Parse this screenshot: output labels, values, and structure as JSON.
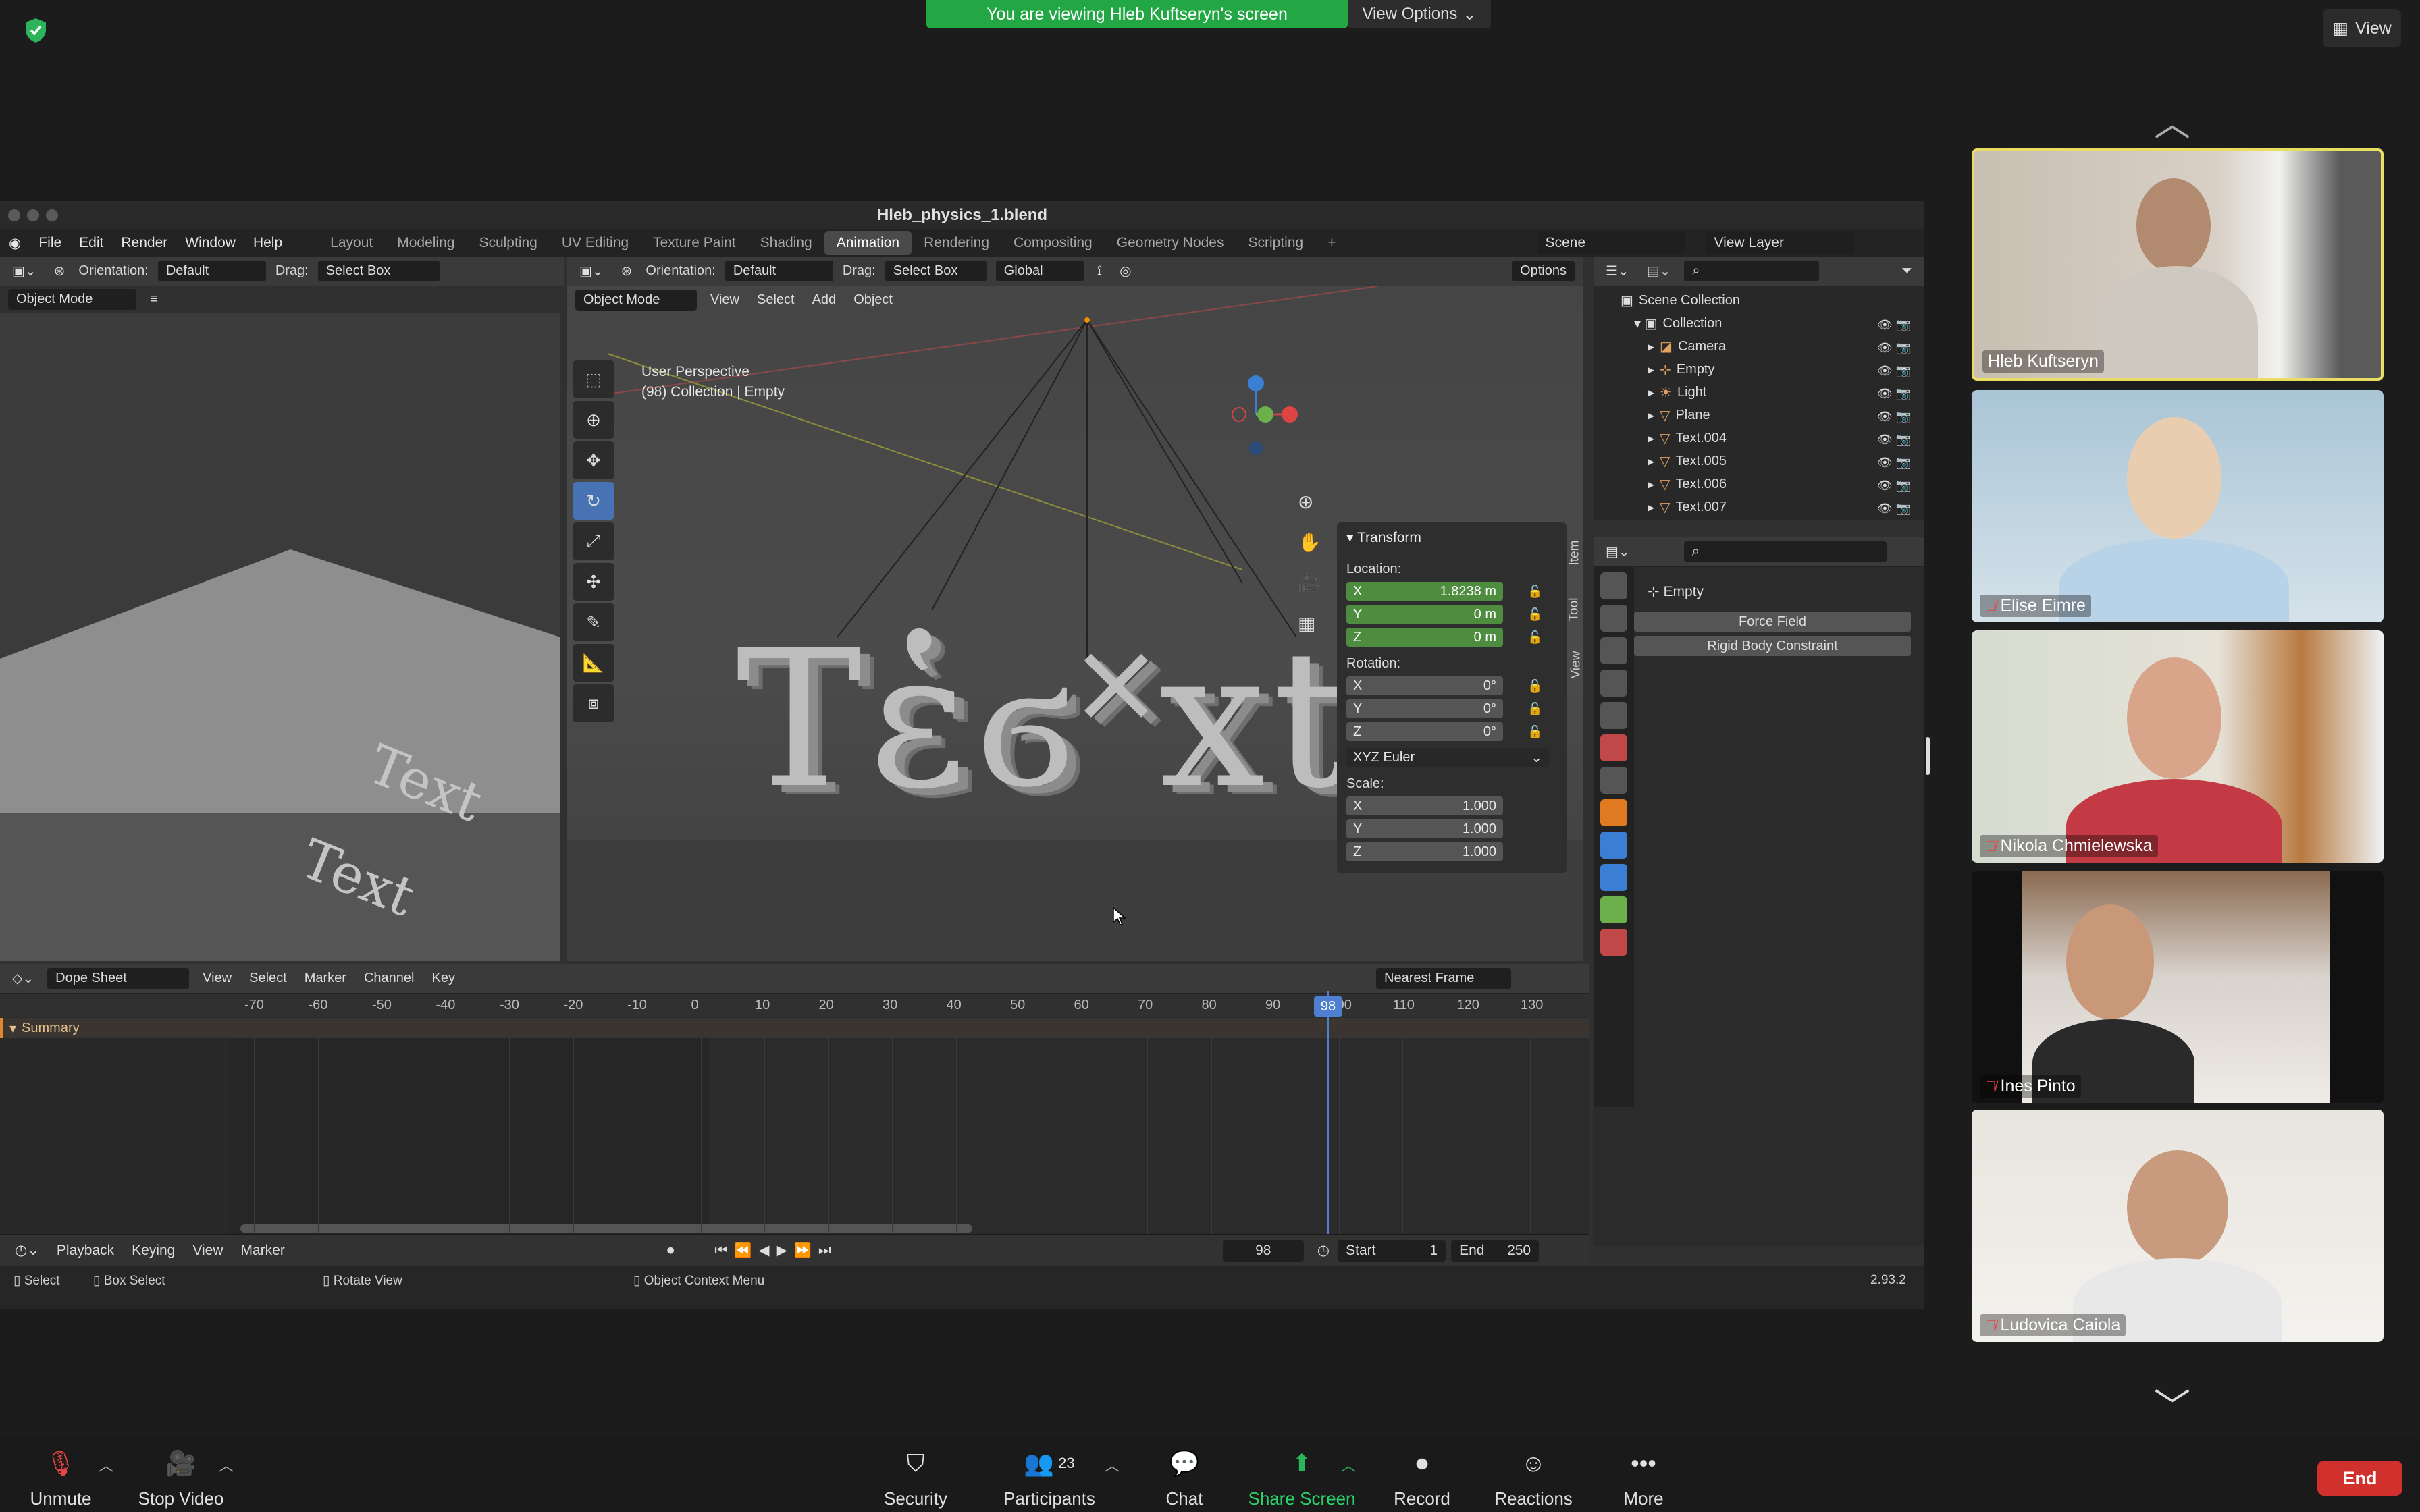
{
  "zoom": {
    "banner_text": "You are viewing Hleb Kuftseryn's screen",
    "view_options_label": "View Options",
    "view_label": "View",
    "bottom_bar": {
      "unmute": "Unmute",
      "stop_video": "Stop Video",
      "security": "Security",
      "participants": "Participants",
      "participants_count": "23",
      "chat": "Chat",
      "share_screen": "Share Screen",
      "record": "Record",
      "reactions": "Reactions",
      "more": "More",
      "end": "End"
    },
    "participants": [
      {
        "name": "Hleb Kuftseryn",
        "muted": false,
        "active": true
      },
      {
        "name": "Elise Eimre",
        "muted": true
      },
      {
        "name": "Nikola Chmielewska",
        "muted": true
      },
      {
        "name": "Ines Pinto",
        "muted": true
      },
      {
        "name": "Ludovica Caiola",
        "muted": true
      }
    ]
  },
  "blender": {
    "window_title": "Hleb_physics_1.blend",
    "menu": [
      "File",
      "Edit",
      "Render",
      "Window",
      "Help"
    ],
    "workspaces": [
      "Layout",
      "Modeling",
      "Sculpting",
      "UV Editing",
      "Texture Paint",
      "Shading",
      "Animation",
      "Rendering",
      "Compositing",
      "Geometry Nodes",
      "Scripting"
    ],
    "active_workspace": "Animation",
    "scene_label": "Scene",
    "view_layer_label": "View Layer",
    "left_header": {
      "orientation_label": "Orientation:",
      "orientation_value": "Default",
      "drag_label": "Drag:",
      "drag_value": "Select Box",
      "object_mode": "Object Mode"
    },
    "main_header": {
      "orientation_label": "Orientation:",
      "orientation_value": "Default",
      "drag_label": "Drag:",
      "drag_value": "Select Box",
      "transform_space": "Global",
      "options": "Options",
      "object_mode": "Object Mode",
      "menus": [
        "View",
        "Select",
        "Add",
        "Object"
      ]
    },
    "viewport": {
      "perspective": "User Perspective",
      "collection_info": "(98) Collection | Empty",
      "text_object": "Tἑϭ˟xt"
    },
    "transform_panel": {
      "title": "Transform",
      "location_label": "Location:",
      "location": {
        "x": "1.8238 m",
        "y": "0 m",
        "z": "0 m"
      },
      "rotation_label": "Rotation:",
      "rotation": {
        "x": "0°",
        "y": "0°",
        "z": "0°"
      },
      "rotation_mode": "XYZ Euler",
      "scale_label": "Scale:",
      "scale": {
        "x": "1.000",
        "y": "1.000",
        "z": "1.000"
      },
      "axis_x": "X",
      "axis_y": "Y",
      "axis_z": "Z"
    },
    "side_tabs": [
      "Item",
      "Tool",
      "View"
    ],
    "outliner": {
      "scene_collection": "Scene Collection",
      "collection": "Collection",
      "items": [
        "Camera",
        "Empty",
        "Light",
        "Plane",
        "Text.004",
        "Text.005",
        "Text.006",
        "Text.007"
      ]
    },
    "properties": {
      "object_name": "Empty",
      "buttons": [
        "Force Field",
        "Rigid Body Constraint"
      ]
    },
    "dope_sheet": {
      "editor": "Dope Sheet",
      "menus": [
        "View",
        "Select",
        "Marker",
        "Channel",
        "Key"
      ],
      "snap": "Nearest Frame",
      "summary": "Summary",
      "ticks": [
        "-70",
        "-60",
        "-50",
        "-40",
        "-30",
        "-20",
        "-10",
        "0",
        "10",
        "20",
        "30",
        "40",
        "50",
        "60",
        "70",
        "80",
        "90",
        "100",
        "110",
        "120",
        "130"
      ],
      "current_frame": "98"
    },
    "timeline": {
      "playback": "Playback",
      "keying": "Keying",
      "view": "View",
      "marker": "Marker",
      "frame": "98",
      "start_label": "Start",
      "start": "1",
      "end_label": "End",
      "end": "250"
    },
    "status_bar": {
      "select": "Select",
      "box_select": "Box Select",
      "rotate_view": "Rotate View",
      "context_menu": "Object Context Menu",
      "version": "2.93.2"
    }
  }
}
